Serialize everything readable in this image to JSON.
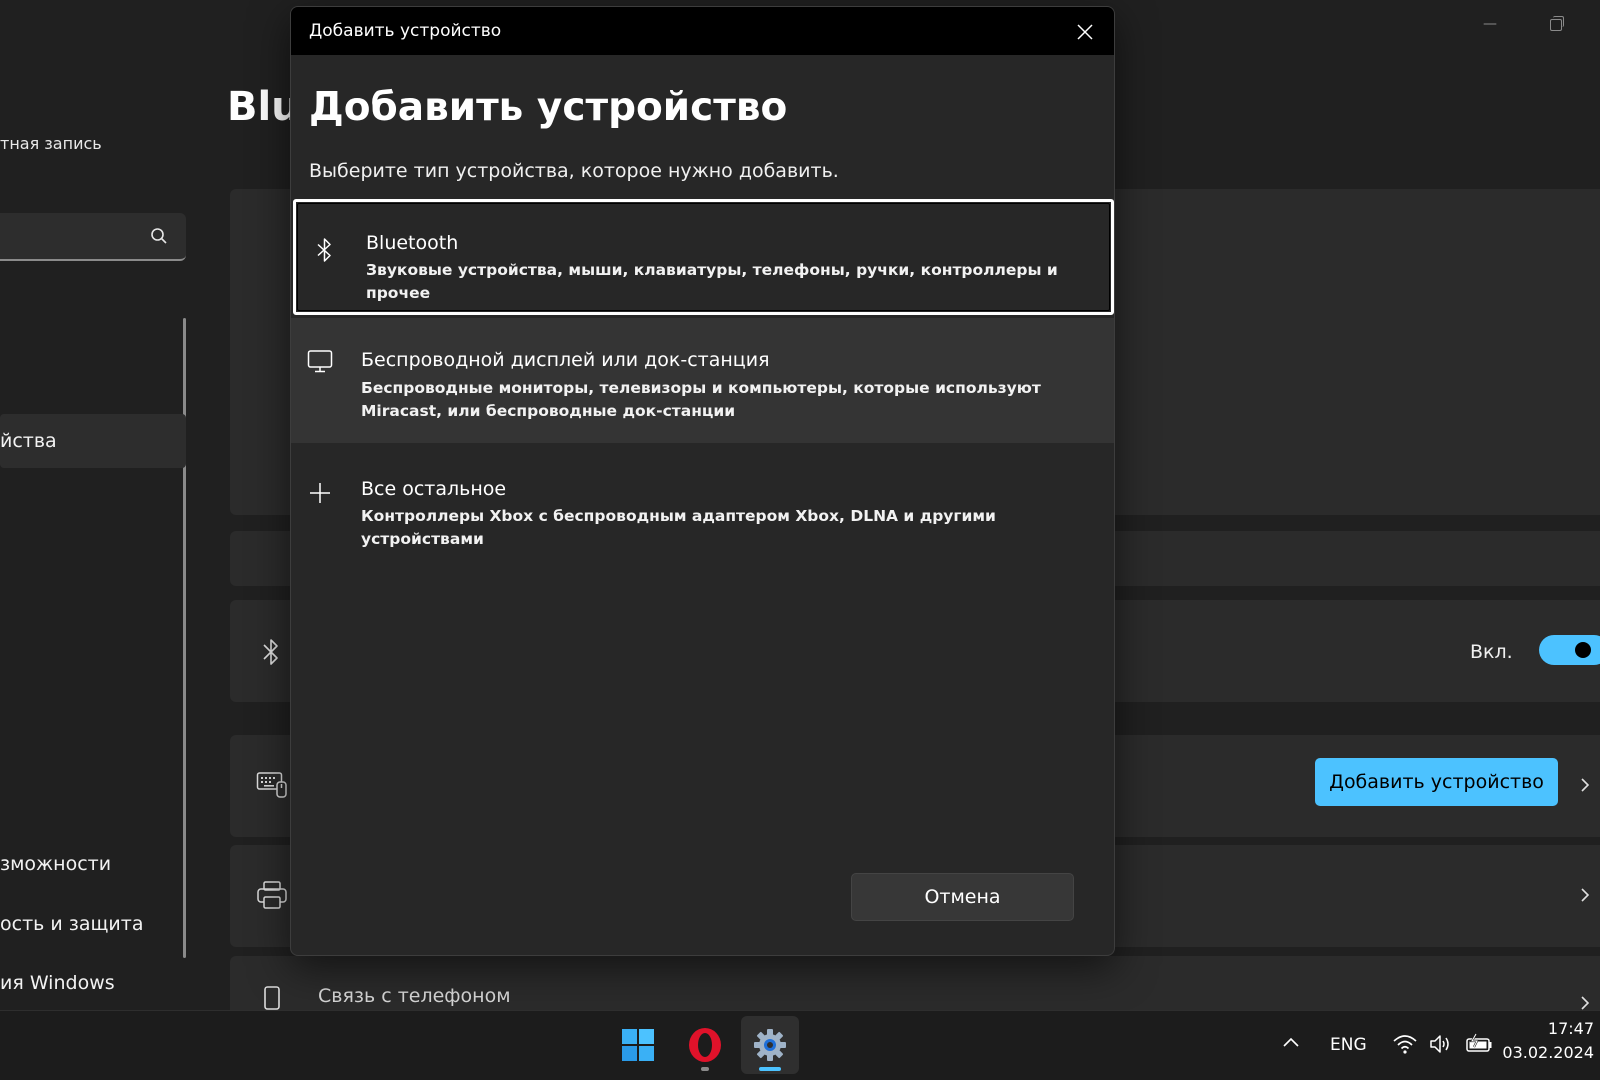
{
  "background": {
    "page_title": "Blu",
    "account_text": "тная запись",
    "nav": {
      "devices": "йства",
      "accessibility": "зможности",
      "privacy": "ость и защита",
      "windows_update": "ия Windows"
    },
    "bluetooth_toggle_label": "Вкл.",
    "bluetooth_toggle_on": true,
    "add_device_button": "Добавить устройство",
    "phone_link": "Связь с телефоном"
  },
  "dialog": {
    "window_title": "Добавить устройство",
    "heading": "Добавить устройство",
    "subtitle": "Выберите тип устройства, которое нужно добавить.",
    "options": [
      {
        "icon": "bluetooth-icon",
        "title": "Bluetooth",
        "description": "Звуковые устройства, мыши, клавиатуры, телефоны, ручки, контроллеры и прочее"
      },
      {
        "icon": "monitor-icon",
        "title": "Беспроводной дисплей или док-станция",
        "description": "Беспроводные мониторы, телевизоры и компьютеры, которые используют Miracast, или беспроводные док-станции"
      },
      {
        "icon": "plus-icon",
        "title": "Все остальное",
        "description": "Контроллеры Xbox с беспроводным адаптером Xbox, DLNA и другими устройствами"
      }
    ],
    "cancel_button": "Отмена"
  },
  "taskbar": {
    "apps": [
      "start-icon",
      "opera-icon",
      "settings-icon"
    ],
    "language": "ENG",
    "time": "17:47",
    "date": "03.02.2024"
  },
  "colors": {
    "accent": "#4cc2ff",
    "background": "#202020",
    "dialog": "#272727",
    "selected_option": "#343434"
  }
}
